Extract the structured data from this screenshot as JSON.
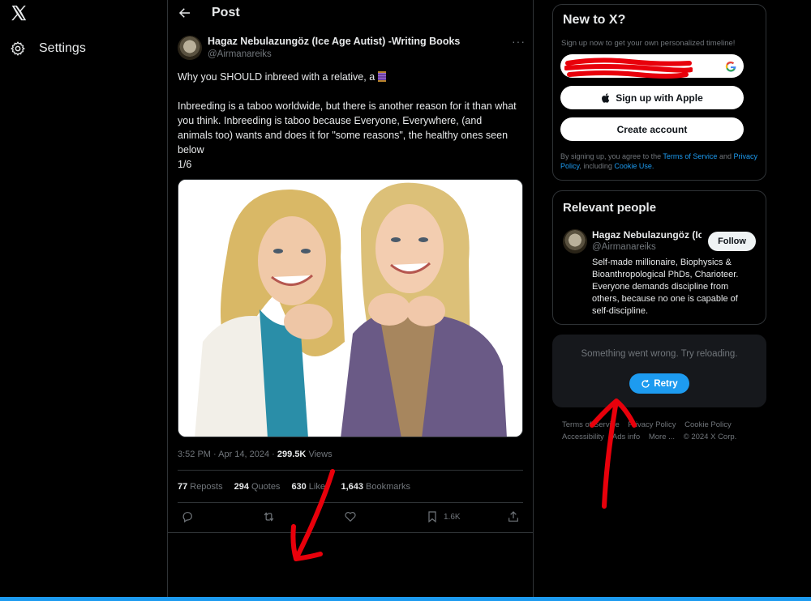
{
  "nav": {
    "logo_icon": "x-logo-icon",
    "settings_label": "Settings"
  },
  "post": {
    "header_title": "Post",
    "author_name": "Hagaz Nebulazungöz (Ice Age Autist) -Writing Books",
    "author_handle": "@Airmanareiks",
    "text_line1": "Why you SHOULD inbreed with a relative, a",
    "text_para2": "Inbreeding is a taboo worldwide, but there is another reason for it than what you think. Inbreeding is taboo because Everyone, Everywhere, (and animals too) wants and does it for \"some reasons\", the healthy ones seen below",
    "text_counter": "1/6",
    "time": "3:52 PM · Apr 14, 2024 · ",
    "views_count": "299.5K",
    "views_label": " Views",
    "stats": [
      {
        "count": "77",
        "label": "Reposts"
      },
      {
        "count": "294",
        "label": "Quotes"
      },
      {
        "count": "630",
        "label": "Likes"
      },
      {
        "count": "1,643",
        "label": "Bookmarks"
      }
    ],
    "bookmark_count": "1.6K"
  },
  "signup": {
    "title": "New to X?",
    "subtitle": "Sign up now to get your own personalized timeline!",
    "apple_label": "Sign up with Apple",
    "create_label": "Create account",
    "legal_pre": "By signing up, you agree to the ",
    "terms": "Terms of Service",
    "legal_and": " and ",
    "privacy": "Privacy Policy",
    "legal_including": ", including ",
    "cookie": "Cookie Use."
  },
  "relevant": {
    "title": "Relevant people",
    "name": "Hagaz Nebulazungöz (Ice Age Autist) -Writing Books",
    "handle": "@Airmanareiks",
    "follow_label": "Follow",
    "bio": "Self-made millionaire, Biophysics & Bioanthropological PhDs, Charioteer. Everyone demands discipline from others, because no one is capable of self-discipline."
  },
  "error": {
    "message": "Something went wrong. Try reloading.",
    "retry_label": "Retry"
  },
  "footer": {
    "links_row1": [
      "Terms of Service",
      "Privacy Policy",
      "Cookie Policy"
    ],
    "links_row2": [
      "Accessibility",
      "Ads info",
      "More ...",
      "© 2024 X Corp."
    ]
  },
  "colors": {
    "accent": "#1d9bf0",
    "background": "#000000",
    "text_primary": "#e7e9ea",
    "text_secondary": "#71767b",
    "annotation_red": "#e8000b"
  }
}
